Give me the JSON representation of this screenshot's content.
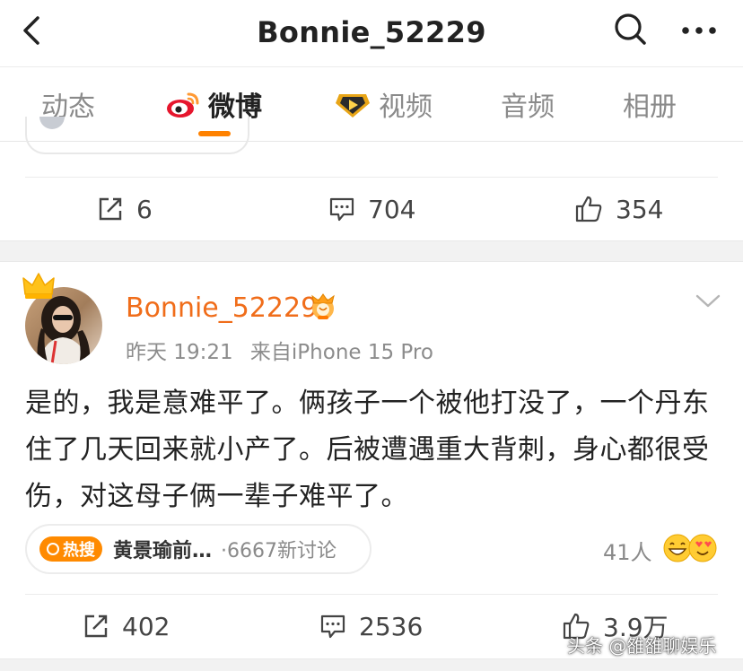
{
  "header": {
    "title": "Bonnie_52229",
    "back_icon": "chevron-left-icon",
    "search_icon": "search-icon",
    "more_icon": "more-icon"
  },
  "tabs": [
    {
      "label": "动态",
      "active": false
    },
    {
      "label": "微博",
      "active": true,
      "icon": "weibo-logo-icon"
    },
    {
      "label": "视频",
      "active": false,
      "icon": "video-badge-icon"
    },
    {
      "label": "音频",
      "active": false
    },
    {
      "label": "相册",
      "active": false
    }
  ],
  "prev_post": {
    "repost_count": "6",
    "comment_count": "704",
    "like_count": "354"
  },
  "post": {
    "username": "Bonnie_52229",
    "time": "昨天 19:21",
    "source": "来自iPhone 15 Pro",
    "text": "是的，我是意难平了。俩孩子一个被他打没了，一个丹东住了几天回来就小产了。后被遭遇重大背刺，身心都很受伤，对这母子俩一辈子难平了。",
    "topic": {
      "hot_label": "热搜",
      "name": "黄景瑜前…",
      "discussions": "·6667新讨论"
    },
    "people_count": "41人",
    "repost_count": "402",
    "comment_count": "2536",
    "like_count": "3.9万"
  },
  "watermark": "头条 @雒雒聊娱乐",
  "colors": {
    "accent": "#ff8200",
    "username": "#f06d1a",
    "gap": "#f2f2f2"
  }
}
